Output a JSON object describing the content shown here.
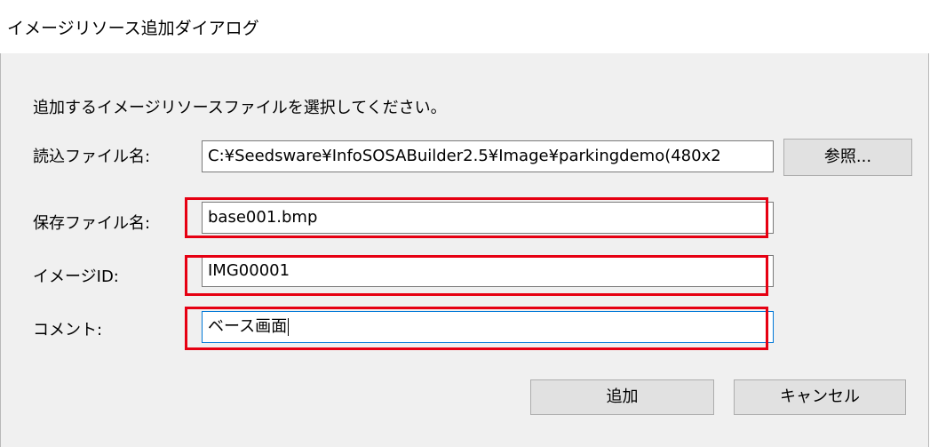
{
  "window": {
    "title": "イメージリソース追加ダイアログ"
  },
  "instruction": "追加するイメージリソースファイルを選択してください。",
  "fields": {
    "load_file": {
      "label": "読込ファイル名:",
      "value": "C:¥Seedsware¥InfoSOSABuilder2.5¥Image¥parkingdemo(480x2"
    },
    "save_file": {
      "label": "保存ファイル名:",
      "value": "base001.bmp"
    },
    "image_id": {
      "label": "イメージID:",
      "value": "IMG00001"
    },
    "comment": {
      "label": "コメント:",
      "value": "ベース画面"
    }
  },
  "buttons": {
    "browse": "参照...",
    "add": "追加",
    "cancel": "キャンセル"
  },
  "colors": {
    "highlight": "#e60012",
    "focus_border": "#0078d7"
  }
}
